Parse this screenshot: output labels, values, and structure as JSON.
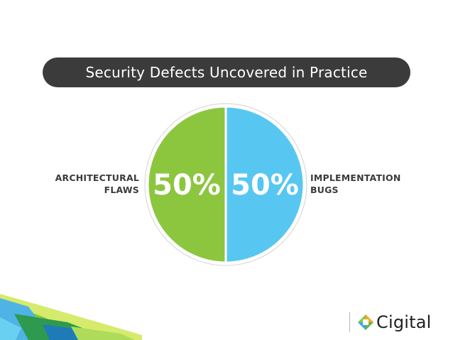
{
  "title": "Security Defects Uncovered in Practice",
  "chart_data": {
    "type": "pie",
    "title": "Security Defects Uncovered in Practice",
    "slices": [
      {
        "label_lines": [
          "ARCHITECTURAL",
          "FLAWS"
        ],
        "value": 50,
        "value_label": "50%",
        "color": "#8cc63f"
      },
      {
        "label_lines": [
          "IMPLEMENTATION",
          "BUGS"
        ],
        "value": 50,
        "value_label": "50%",
        "color": "#57c7f2"
      }
    ],
    "legend": "none"
  },
  "logo": {
    "text": "Cigital"
  },
  "colors": {
    "title_bg": "#3b3b3b",
    "text_dark": "#3b3b3b",
    "green": "#8cc63f",
    "blue": "#57c7f2"
  }
}
